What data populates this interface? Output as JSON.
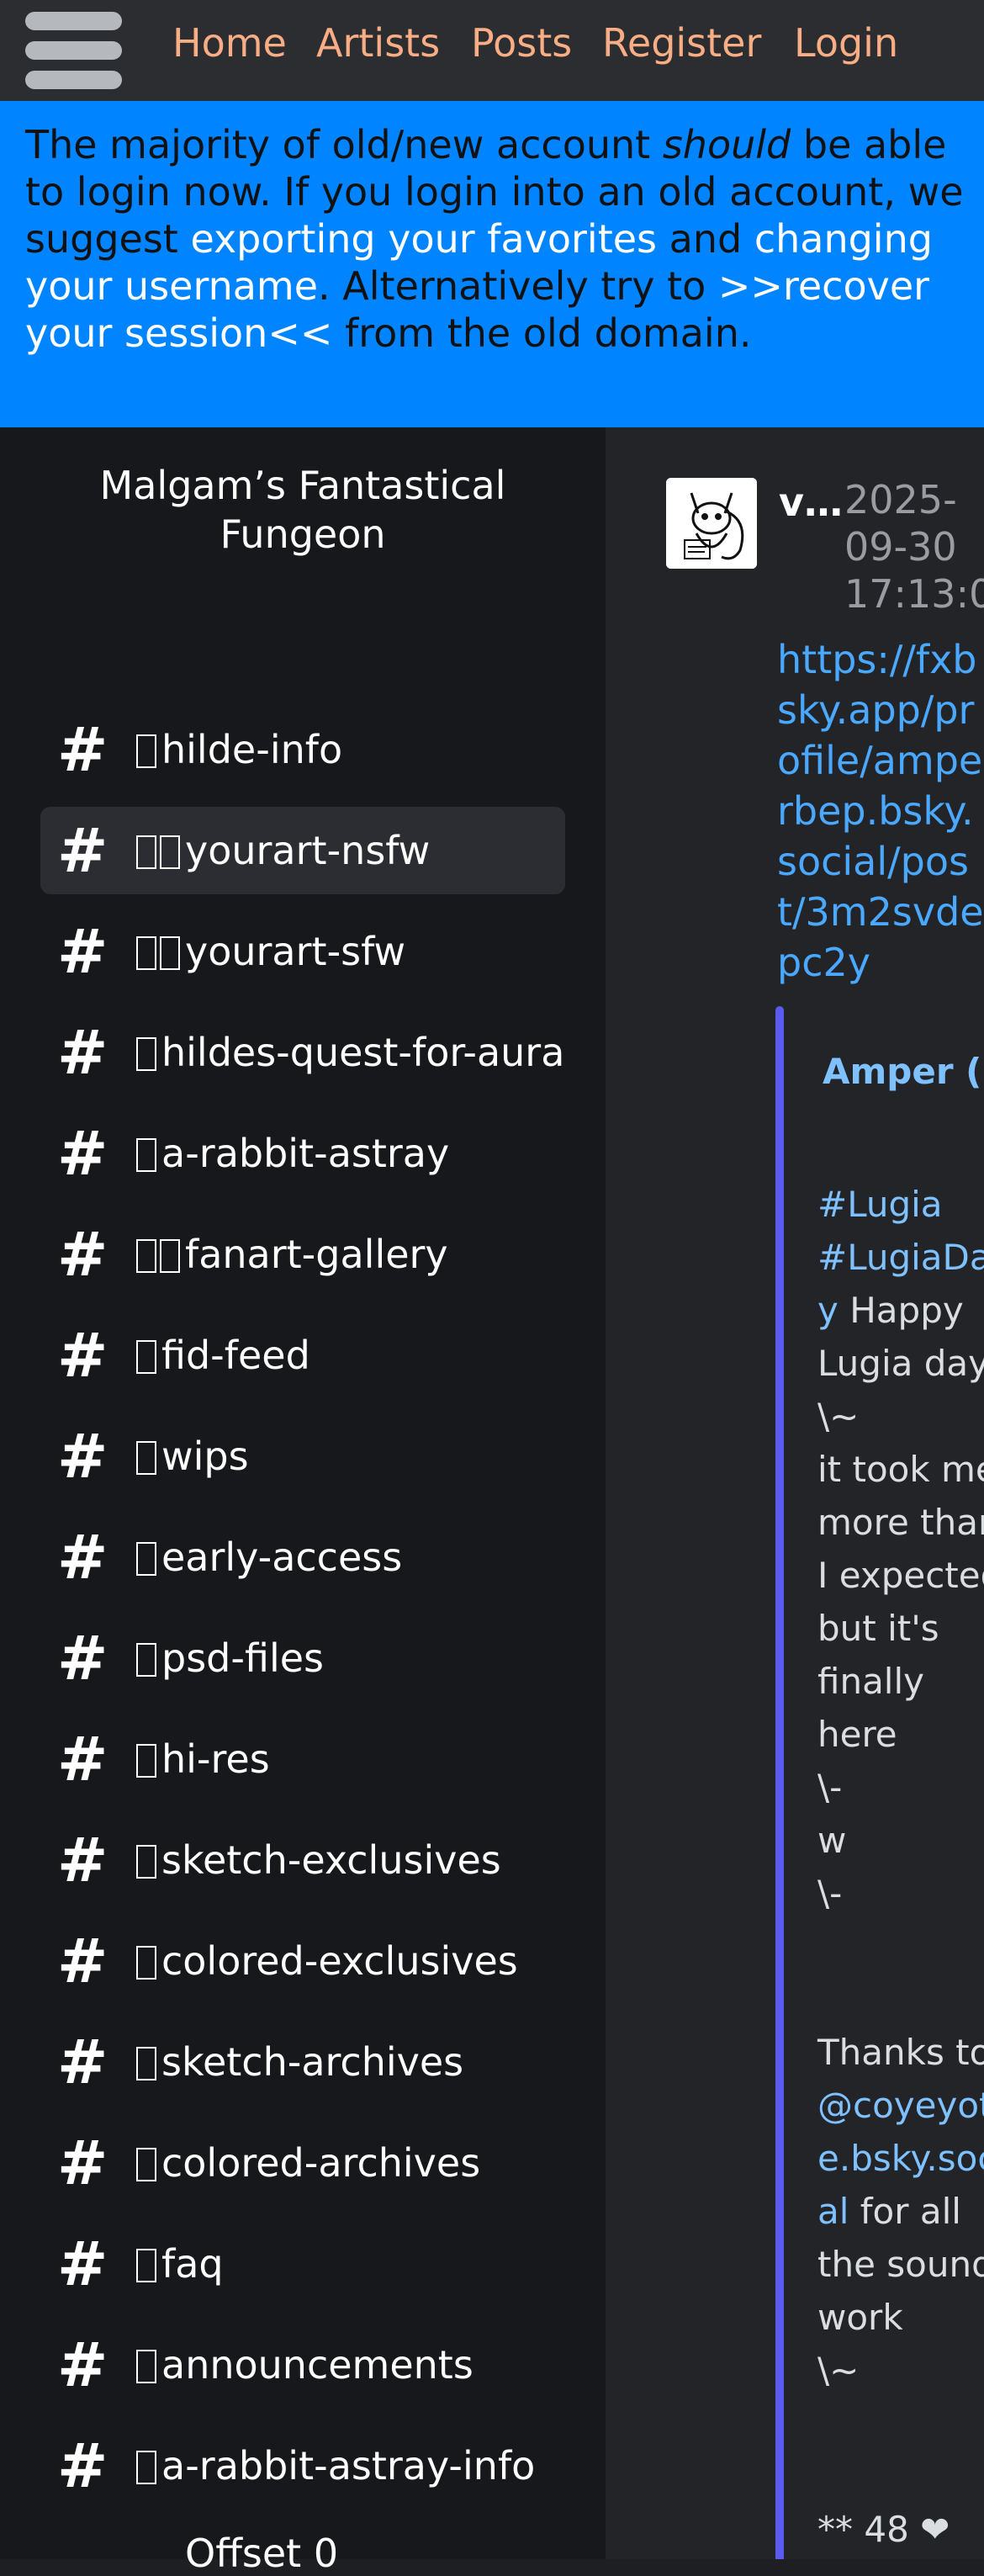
{
  "nav": {
    "items": [
      "Home",
      "Artists",
      "Posts",
      "Register",
      "Login"
    ]
  },
  "banner": {
    "p1": "The majority of old/new account ",
    "p2": "should",
    "p3": " be able to login now. If you login into an old account, we suggest ",
    "l1": "exporting your favorites",
    "p4": " and ",
    "l2": "changing your username",
    "p5": ". Alternatively try to ",
    "l3": ">>recover your session<<",
    "p6": " from the old domain."
  },
  "sidebar": {
    "server_name": "Malgam’s Fantastical Fungeon",
    "channels": [
      {
        "emojis": 1,
        "name": "hilde-info"
      },
      {
        "emojis": 2,
        "name": "yourart-nsfw",
        "active": true
      },
      {
        "emojis": 2,
        "name": "yourart-sfw"
      },
      {
        "emojis": 1,
        "name": "hildes-quest-for-aura"
      },
      {
        "emojis": 1,
        "name": "a-rabbit-astray"
      },
      {
        "emojis": 2,
        "name": "fanart-gallery"
      },
      {
        "emojis": 1,
        "name": "fid-feed"
      },
      {
        "emojis": 1,
        "name": "wips"
      },
      {
        "emojis": 1,
        "name": "early-access"
      },
      {
        "emojis": 1,
        "name": "psd-files"
      },
      {
        "emojis": 1,
        "name": "hi-res"
      },
      {
        "emojis": 1,
        "name": "sketch-exclusives"
      },
      {
        "emojis": 1,
        "name": "colored-exclusives"
      },
      {
        "emojis": 1,
        "name": "sketch-archives"
      },
      {
        "emojis": 1,
        "name": "colored-archives"
      },
      {
        "emojis": 1,
        "name": "faq"
      },
      {
        "emojis": 1,
        "name": "announcements"
      },
      {
        "emojis": 1,
        "name": "a-rabbit-astray-info"
      }
    ],
    "offset_label": "Offset 0"
  },
  "post": {
    "username": "v…",
    "timestamp": "2025-09-30 17:13:0",
    "link": "https://fxbsky.app/profile/amperbep.bsky.social/post/3m2svdepc2y",
    "embed": {
      "author": "Amper (@ampe",
      "tag1": "#Lugia",
      "tag2": "#LugiaDay",
      "t1": "Happy Lugia day \\~",
      "t2": "it took me more than I expected but it's finally here",
      "t3": "\\-",
      "t4": "w",
      "t5": "\\-",
      "t6": "Thanks to",
      "mention": "@coyeyote.bsky.social",
      "t7": "for all the sound work",
      "t8": "\\~",
      "footer": "** 48 ❤"
    }
  }
}
